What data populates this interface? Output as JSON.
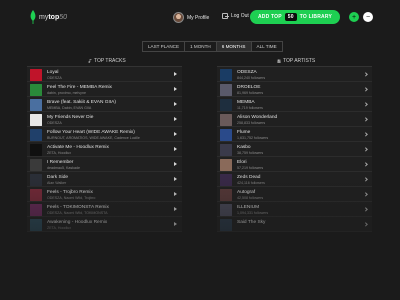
{
  "brand": {
    "prefix": "my",
    "strong": "top",
    "suffix": "50"
  },
  "header": {
    "profile_label": "My Profile",
    "logout_label": "Log Out",
    "cta_prefix": "ADD TOP",
    "cta_badge": "50",
    "cta_suffix": "TO LIBRARY",
    "plus_symbol": "+",
    "minus_symbol": "−"
  },
  "tabs": [
    {
      "label": "LAST PLANCE",
      "active": false
    },
    {
      "label": "1 MONTH",
      "active": false
    },
    {
      "label": "6 MONTHS",
      "active": true
    },
    {
      "label": "ALL TIME",
      "active": false
    }
  ],
  "sections": {
    "tracks_title": "TOP TRACKS",
    "artists_title": "TOP ARTISTS"
  },
  "tracks": [
    {
      "title": "Loyal",
      "artist": "ODESZA",
      "art": "#c0142a"
    },
    {
      "title": "Feel The Fire - MEMBA Remix",
      "artist": "dabin, proximo, melvyne",
      "art": "#2a8a3a"
    },
    {
      "title": "Brave (feat. Sakiit & EVAN GIIA)",
      "artist": "MEMBA, Dabin, EVAN GIIA",
      "art": "#4a6fa0"
    },
    {
      "title": "My Friends Never Die",
      "artist": "ODESZA",
      "art": "#e8e8e8"
    },
    {
      "title": "Follow Your Heart (WIDE AWAKE Remix)",
      "artist": "BURNOUT, AROMATIOS, WIDE AWAKE, Cadence Lucille",
      "art": "#20406a"
    },
    {
      "title": "Activate Me - Hoodlux Remix",
      "artist": "ZETA, Hoodlux",
      "art": "#101010"
    },
    {
      "title": "I Remember",
      "artist": "deadmau5, Kaskade",
      "art": "#3a3a3a"
    },
    {
      "title": "Dark Side",
      "artist": "Alan Walker",
      "art": "#2b2f38"
    },
    {
      "title": "Feels - Trojbro Remix",
      "artist": "ODESZA, Naomi Wild, Trojbro",
      "art": "#7a2a3a"
    },
    {
      "title": "Feels - TOKIMONSTA Remix",
      "artist": "ODESZA, Naomi Wild, TOKIMONSTA",
      "art": "#6a2a5a"
    },
    {
      "title": "Awakening - Hoodlux Remix",
      "artist": "ZETA, Hoodlux",
      "art": "#2a4a5a"
    }
  ],
  "artists": [
    {
      "name": "ODESZA",
      "followers": "844,240 followers",
      "art": "#1a3c64"
    },
    {
      "name": "DROELOE",
      "followers": "81,969 followers",
      "art": "#5a5a6a"
    },
    {
      "name": "MEMBA",
      "followers": "11,719 followers",
      "art": "#1e2e3e"
    },
    {
      "name": "Alison Wonderland",
      "followers": "258,833 followers",
      "art": "#6a5a5a"
    },
    {
      "name": "Flume",
      "followers": "1,631,752 followers",
      "art": "#2a4a8a"
    },
    {
      "name": "Kasbo",
      "followers": "38,759 followers",
      "art": "#3a3a4a"
    },
    {
      "name": "Elori",
      "followers": "57,219 followers",
      "art": "#8a6a5a"
    },
    {
      "name": "Zeds Dead",
      "followers": "424,116 followers",
      "art": "#3a2a4a"
    },
    {
      "name": "Autograf",
      "followers": "42,508 followers",
      "art": "#5a3a3a"
    },
    {
      "name": "ILLENIUM",
      "followers": "1,094,331 followers",
      "art": "#4a4a5a"
    },
    {
      "name": "Said The Sky",
      "followers": "",
      "art": "#2a3a4a"
    }
  ],
  "colors": {
    "accent": "#1ecf52",
    "background": "#1b1b1b",
    "row": "#202020"
  },
  "icons": {
    "track_action": "play-icon",
    "artist_action": "chevron-right-icon"
  }
}
